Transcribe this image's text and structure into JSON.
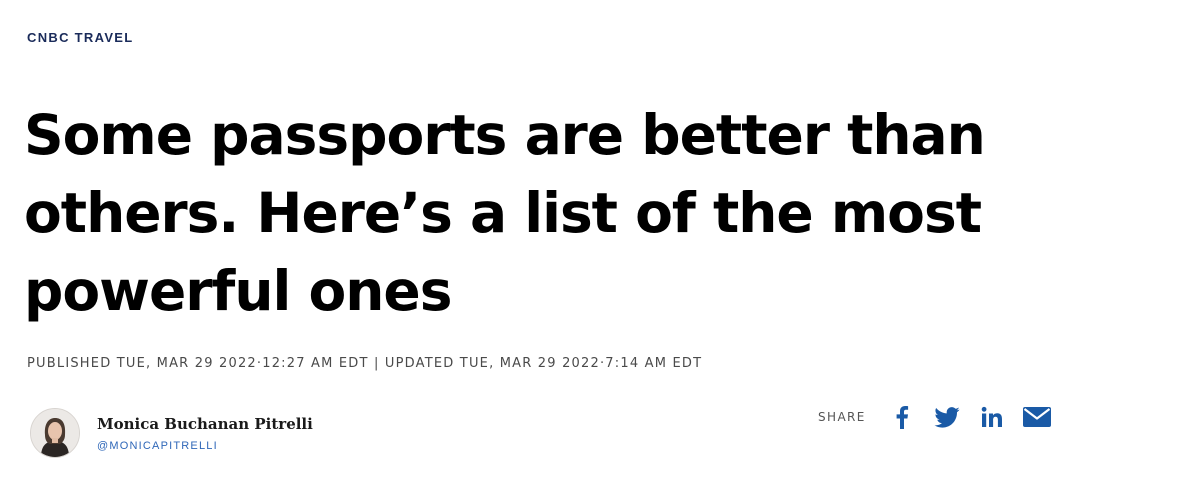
{
  "article": {
    "section": "CNBC TRAVEL",
    "headline": "Some passports are better than others. Here’s a list of the most powerful ones",
    "timestamp": "PUBLISHED TUE, MAR 29 2022·12:27 AM EDT | UPDATED TUE, MAR 29 2022·7:14 AM EDT"
  },
  "author": {
    "name": "Monica Buchanan Pitrelli",
    "handle": "@MONICAPITRELLI"
  },
  "share": {
    "label": "SHARE",
    "icons": [
      "facebook-icon",
      "twitter-icon",
      "linkedin-icon",
      "email-icon"
    ],
    "icon_color": "#1a5aa6"
  },
  "colors": {
    "section": "#1a2b5a",
    "handle": "#2f67b8",
    "share_icons": "#1a5aa6"
  }
}
